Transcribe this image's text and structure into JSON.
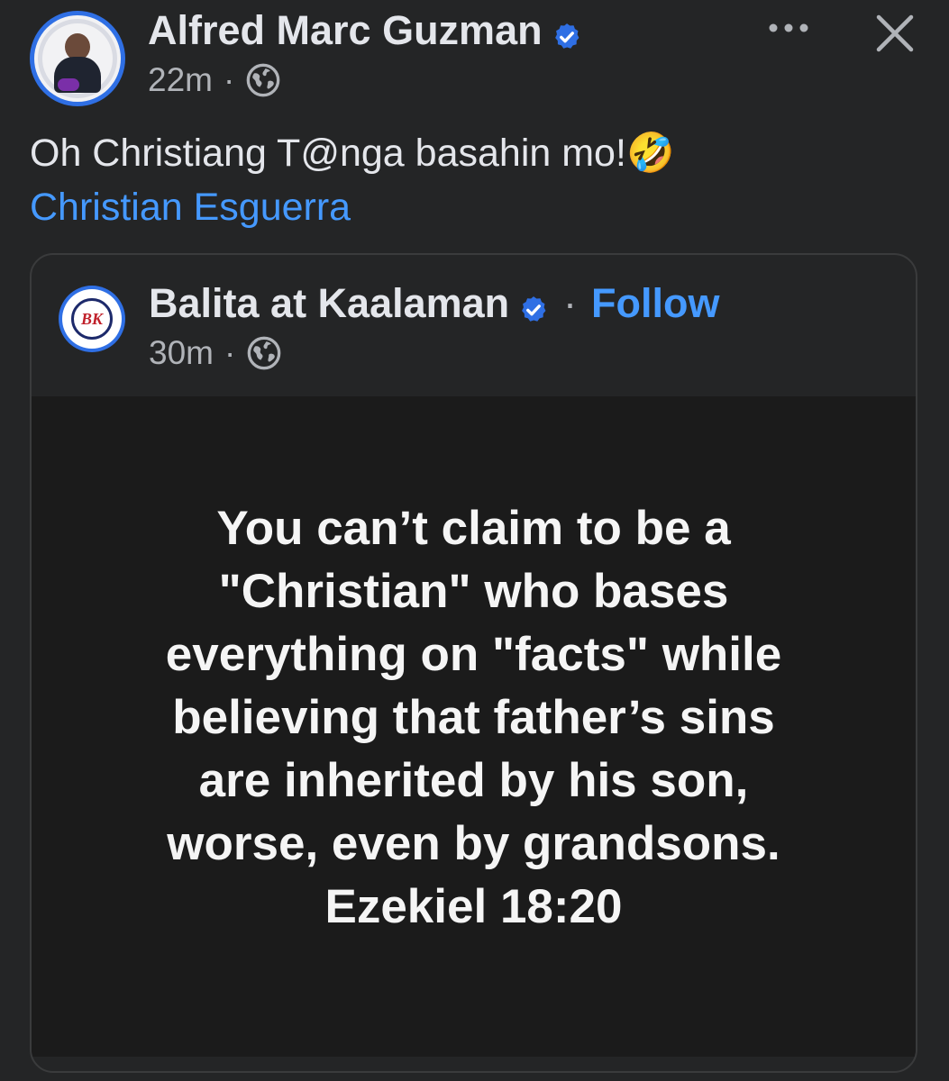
{
  "post": {
    "author": "Alfred Marc Guzman",
    "time": "22m",
    "separator": "·",
    "caption_text": "Oh Christiang T@nga basahin mo!",
    "caption_emoji": "🤣",
    "mention": "Christian Esguerra"
  },
  "shared": {
    "page_name": "Balita at Kaalaman",
    "follow_separator": "·",
    "follow_label": "Follow",
    "time": "30m",
    "separator": "·",
    "avatar_letters": "BK",
    "quote_lines": [
      "You can’t claim to be a",
      "\"Christian\" who bases",
      "everything on \"facts\" while",
      "believing that father’s sins",
      "are inherited by his son,",
      "worse, even by grandsons.",
      "Ezekiel 18:20"
    ]
  },
  "colors": {
    "background": "#242526",
    "link": "#4599ff",
    "verified": "#2f6fe4",
    "quote_background": "#1b1b1b"
  },
  "icons": [
    "verified-badge-icon",
    "globe-icon",
    "more-options-icon",
    "close-icon"
  ]
}
